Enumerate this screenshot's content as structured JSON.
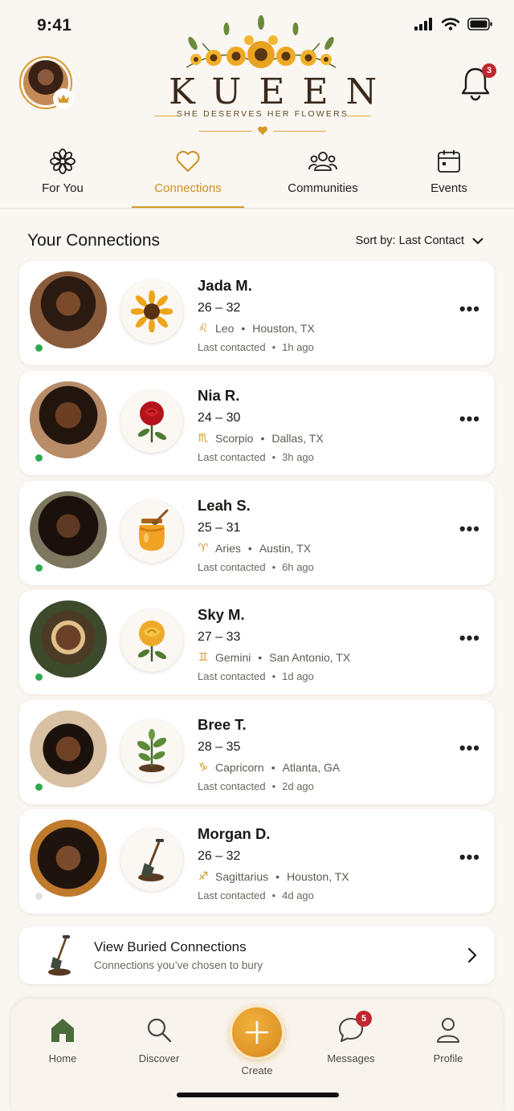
{
  "status_bar": {
    "time": "9:41"
  },
  "brand": {
    "name": "KUEEN",
    "tagline": "SHE DESERVES HER FLOWERS",
    "notification_count": "3"
  },
  "tabs": [
    {
      "label": "For You",
      "icon": "flower-icon",
      "active": false
    },
    {
      "label": "Connections",
      "icon": "heart-icon",
      "active": true
    },
    {
      "label": "Communities",
      "icon": "people-icon",
      "active": false
    },
    {
      "label": "Events",
      "icon": "calendar-icon",
      "active": false
    }
  ],
  "connections_section": {
    "title": "Your Connections",
    "sort_label": "Sort by: Last Contact"
  },
  "connections": [
    {
      "name": "Jada M.",
      "age_range": "26 – 32",
      "zodiac_symbol": "♌",
      "zodiac": "Leo",
      "location": "Houston, TX",
      "last_contacted_label": "Last contacted",
      "last_contacted": "1h ago",
      "flower": "sunflower-icon",
      "online": true
    },
    {
      "name": "Nia R.",
      "age_range": "24 – 30",
      "zodiac_symbol": "♏",
      "zodiac": "Scorpio",
      "location": "Dallas, TX",
      "last_contacted_label": "Last contacted",
      "last_contacted": "3h ago",
      "flower": "red-rose-icon",
      "online": true
    },
    {
      "name": "Leah S.",
      "age_range": "25 – 31",
      "zodiac_symbol": "♈",
      "zodiac": "Aries",
      "location": "Austin, TX",
      "last_contacted_label": "Last contacted",
      "last_contacted": "6h ago",
      "flower": "honey-jar-icon",
      "online": true
    },
    {
      "name": "Sky M.",
      "age_range": "27 – 33",
      "zodiac_symbol": "♊",
      "zodiac": "Gemini",
      "location": "San Antonio, TX",
      "last_contacted_label": "Last contacted",
      "last_contacted": "1d ago",
      "flower": "yellow-rose-icon",
      "online": true
    },
    {
      "name": "Bree T.",
      "age_range": "28 – 35",
      "zodiac_symbol": "♑",
      "zodiac": "Capricorn",
      "location": "Atlanta, GA",
      "last_contacted_label": "Last contacted",
      "last_contacted": "2d ago",
      "flower": "seedling-icon",
      "online": true
    },
    {
      "name": "Morgan D.",
      "age_range": "26 – 32",
      "zodiac_symbol": "♐",
      "zodiac": "Sagittarius",
      "location": "Houston, TX",
      "last_contacted_label": "Last contacted",
      "last_contacted": "4d ago",
      "flower": "shovel-icon",
      "online": false
    }
  ],
  "buried": {
    "title": "View Buried Connections",
    "subtitle": "Connections you’ve chosen to bury"
  },
  "bottom_nav": {
    "home": "Home",
    "discover": "Discover",
    "create": "Create",
    "messages": "Messages",
    "messages_badge": "5",
    "profile": "Profile"
  },
  "colors": {
    "accent": "#d39a2c",
    "background": "#faf6f1",
    "online": "#2fa84f",
    "badge": "#c0262d"
  }
}
